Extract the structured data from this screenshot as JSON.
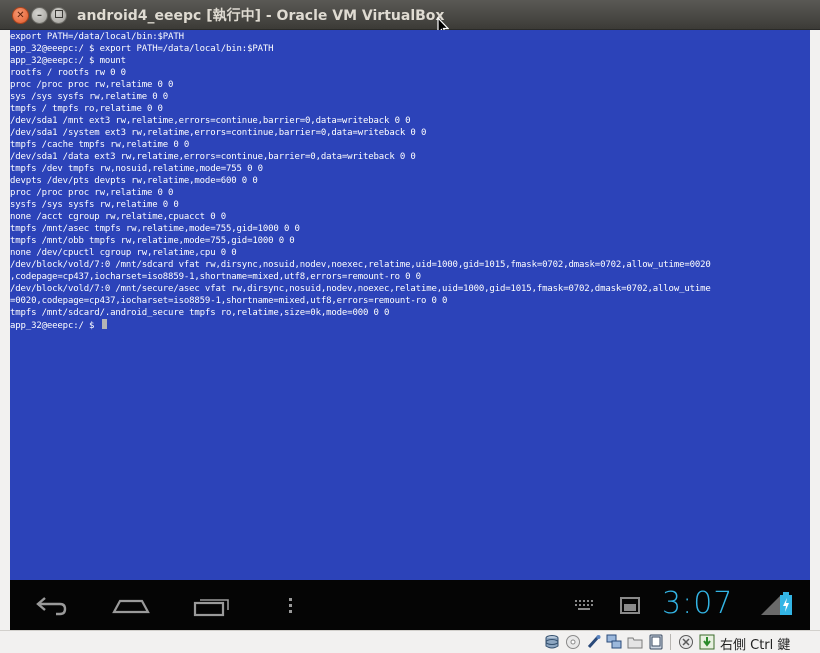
{
  "window": {
    "title": "android4_eeepc [執行中] - Oracle VM VirtualBox"
  },
  "terminal": {
    "lines": [
      "export PATH=/data/local/bin:$PATH",
      "app_32@eeepc:/ $ export PATH=/data/local/bin:$PATH",
      "app_32@eeepc:/ $ mount",
      "rootfs / rootfs rw 0 0",
      "proc /proc proc rw,relatime 0 0",
      "sys /sys sysfs rw,relatime 0 0",
      "tmpfs / tmpfs ro,relatime 0 0",
      "/dev/sda1 /mnt ext3 rw,relatime,errors=continue,barrier=0,data=writeback 0 0",
      "/dev/sda1 /system ext3 rw,relatime,errors=continue,barrier=0,data=writeback 0 0",
      "tmpfs /cache tmpfs rw,relatime 0 0",
      "/dev/sda1 /data ext3 rw,relatime,errors=continue,barrier=0,data=writeback 0 0",
      "tmpfs /dev tmpfs rw,nosuid,relatime,mode=755 0 0",
      "devpts /dev/pts devpts rw,relatime,mode=600 0 0",
      "proc /proc proc rw,relatime 0 0",
      "sysfs /sys sysfs rw,relatime 0 0",
      "none /acct cgroup rw,relatime,cpuacct 0 0",
      "tmpfs /mnt/asec tmpfs rw,relatime,mode=755,gid=1000 0 0",
      "tmpfs /mnt/obb tmpfs rw,relatime,mode=755,gid=1000 0 0",
      "none /dev/cpuctl cgroup rw,relatime,cpu 0 0",
      "/dev/block/vold/7:0 /mnt/sdcard vfat rw,dirsync,nosuid,nodev,noexec,relatime,uid=1000,gid=1015,fmask=0702,dmask=0702,allow_utime=0020",
      ",codepage=cp437,iocharset=iso8859-1,shortname=mixed,utf8,errors=remount-ro 0 0",
      "/dev/block/vold/7:0 /mnt/secure/asec vfat rw,dirsync,nosuid,nodev,noexec,relatime,uid=1000,gid=1015,fmask=0702,dmask=0702,allow_utime",
      "=0020,codepage=cp437,iocharset=iso8859-1,shortname=mixed,utf8,errors=remount-ro 0 0",
      "tmpfs /mnt/sdcard/.android_secure tmpfs ro,relatime,size=0k,mode=000 0 0"
    ],
    "prompt": "app_32@eeepc:/ $ "
  },
  "android": {
    "clock": "3:07",
    "accent": "#33b5e5",
    "nav_icons": [
      "back-icon",
      "home-icon",
      "recent-apps-icon",
      "menu-icon"
    ],
    "status_icons": [
      "keyboard-icon",
      "screenshot-icon",
      "signal-icon",
      "battery-charging-icon"
    ]
  },
  "statusbar": {
    "hostkey": "右側 Ctrl 鍵",
    "icons": [
      "hard-disk-icon",
      "optical-drive-icon",
      "usb-icon",
      "network-icon",
      "shared-folder-icon",
      "display-icon",
      "video-capture-icon",
      "mouse-integration-icon",
      "keyboard-capture-icon"
    ]
  },
  "colors": {
    "terminal_bg": "#2c43b9",
    "titlebar": "#3c3b37"
  }
}
